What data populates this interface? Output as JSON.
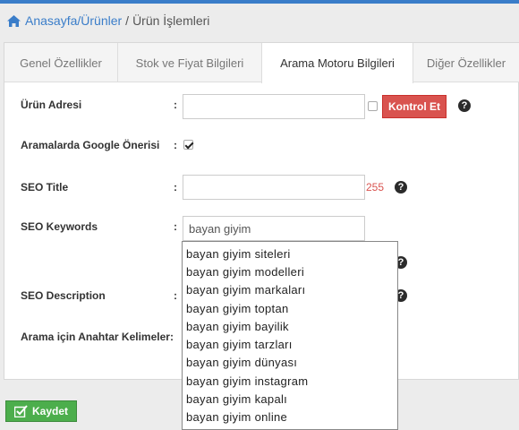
{
  "breadcrumb": {
    "home_icon": "home-icon",
    "link": "Anasayfa/Ürünler",
    "separator": "/",
    "current": "Ürün İşlemleri"
  },
  "tabs": [
    {
      "label": "Genel Özellikler",
      "active": false
    },
    {
      "label": "Stok ve Fiyat Bilgileri",
      "active": false
    },
    {
      "label": "Arama Motoru Bilgileri",
      "active": true
    },
    {
      "label": "Diğer Özellikler",
      "active": false
    }
  ],
  "form": {
    "urun_adresi": {
      "label": "Ürün Adresi",
      "value": "",
      "check_button": "Kontrol Et"
    },
    "google_onerisi": {
      "label": "Aramalarda Google Önerisi",
      "checked": true
    },
    "seo_title": {
      "label": "SEO Title",
      "value": "",
      "counter": "255"
    },
    "seo_keywords": {
      "label": "SEO Keywords",
      "value": "bayan giyim"
    },
    "seo_description": {
      "label": "SEO Description"
    },
    "anahtar_kelimeler": {
      "label": "Arama için Anahtar Kelimeler:"
    },
    "colon": ":"
  },
  "suggestions": [
    "bayan giyim siteleri",
    "bayan giyim modelleri",
    "bayan giyim markaları",
    "bayan giyim toptan",
    "bayan giyim bayilik",
    "bayan giyim tarzları",
    "bayan giyim dünyası",
    "bayan giyim instagram",
    "bayan giyim kapalı",
    "bayan giyim online"
  ],
  "save_button": {
    "label": "Kaydet",
    "icon": "checkbox-edit-icon"
  },
  "help_glyph": "?",
  "colors": {
    "accent": "#3a7dc9",
    "danger": "#d9534f",
    "success": "#4cae4c"
  }
}
